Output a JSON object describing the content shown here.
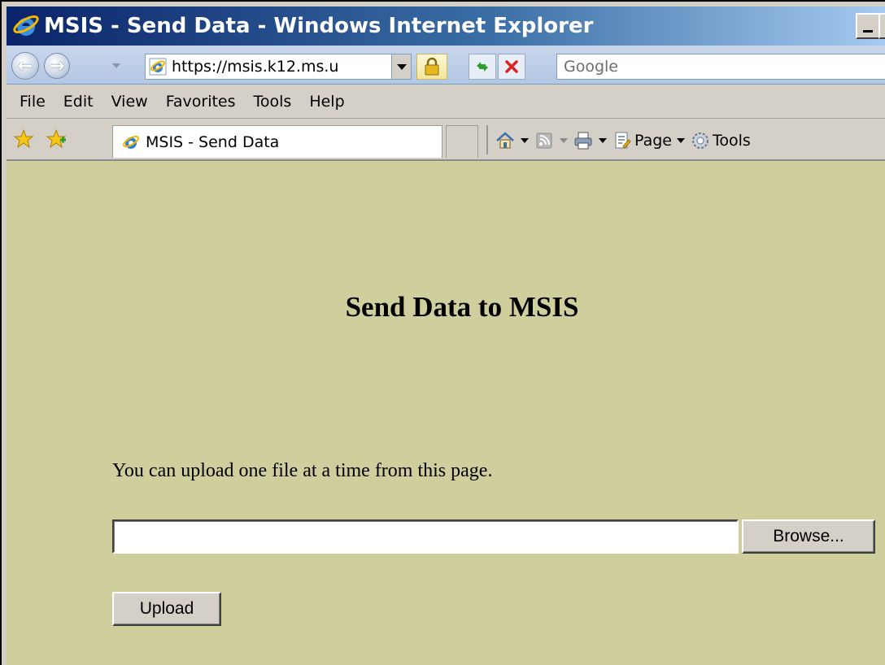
{
  "window": {
    "title": "MSIS - Send Data - Windows Internet Explorer"
  },
  "addressbar": {
    "url": "https://msis.k12.ms.u",
    "search_placeholder": "Google"
  },
  "menubar": {
    "items": [
      "File",
      "Edit",
      "View",
      "Favorites",
      "Tools",
      "Help"
    ]
  },
  "tabbar": {
    "tab_title": "MSIS - Send Data",
    "page_label": "Page",
    "tools_label": "Tools"
  },
  "content": {
    "heading": "Send Data to MSIS",
    "info": "You can upload one file at a time from this page.",
    "file_value": "",
    "browse_label": "Browse...",
    "upload_label": "Upload"
  },
  "colors": {
    "content_background": "#cfce9d",
    "title_gradient_start": "#0a246a"
  },
  "icons": [
    "ie-logo-icon",
    "back-icon",
    "forward-icon",
    "lock-icon",
    "refresh-icon",
    "stop-icon",
    "favorites-star-icon",
    "add-favorite-icon",
    "home-icon",
    "feeds-icon",
    "print-icon",
    "page-icon",
    "tools-gear-icon"
  ]
}
